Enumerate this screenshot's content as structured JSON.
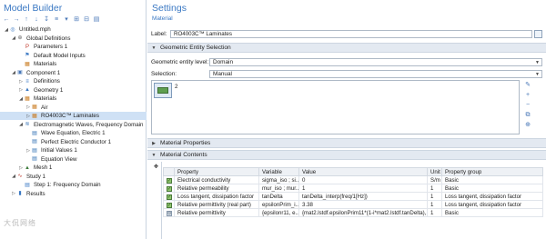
{
  "model_builder": {
    "title": "Model Builder",
    "toolbar": [
      "←",
      "→",
      "↑",
      "↓",
      "↧",
      "≡",
      "▾",
      "⊞",
      "⊟",
      "▤"
    ],
    "tree": [
      {
        "label": "Untitled.mph",
        "icon": "◎",
        "color": "#3a78c3",
        "twisty": "◢",
        "selected": false
      },
      {
        "label": "Global Definitions",
        "icon": "⊕",
        "color": "#6b6b6b",
        "twisty": "◢",
        "selected": false
      },
      {
        "label": "Parameters 1",
        "icon": "P",
        "color": "#c0392b",
        "twisty": "",
        "selected": false
      },
      {
        "label": "Default Model Inputs",
        "icon": "⚑",
        "color": "#3a78c3",
        "twisty": "",
        "selected": false
      },
      {
        "label": "Materials",
        "icon": "▦",
        "color": "#c97a1e",
        "twisty": "",
        "selected": false
      },
      {
        "label": "Component 1",
        "icon": "▣",
        "color": "#4a78b8",
        "twisty": "◢",
        "selected": false
      },
      {
        "label": "Definitions",
        "icon": "≡",
        "color": "#3a78c3",
        "twisty": "▷",
        "selected": false
      },
      {
        "label": "Geometry 1",
        "icon": "▲",
        "color": "#3a78c3",
        "twisty": "▷",
        "selected": false
      },
      {
        "label": "Materials",
        "icon": "▦",
        "color": "#c97a1e",
        "twisty": "◢",
        "selected": false
      },
      {
        "label": "Air",
        "icon": "▦",
        "color": "#c97a1e",
        "twisty": "▷",
        "selected": false
      },
      {
        "label": "RO4003C™ Laminates",
        "icon": "▦",
        "color": "#c97a1e",
        "twisty": "▷",
        "selected": true
      },
      {
        "label": "Electromagnetic Waves, Frequency Domain",
        "icon": "≋",
        "color": "#2f6fb3",
        "twisty": "◢",
        "selected": false
      },
      {
        "label": "Wave Equation, Electric 1",
        "icon": "▤",
        "color": "#2f6fb3",
        "twisty": "",
        "selected": false
      },
      {
        "label": "Perfect Electric Conductor 1",
        "icon": "▤",
        "color": "#2f6fb3",
        "twisty": "",
        "selected": false
      },
      {
        "label": "Initial Values 1",
        "icon": "▤",
        "color": "#2f6fb3",
        "twisty": "▷",
        "selected": false
      },
      {
        "label": "Equation View",
        "icon": "▤",
        "color": "#2f6fb3",
        "twisty": "",
        "selected": false
      },
      {
        "label": "Mesh 1",
        "icon": "▲",
        "color": "#3d7b3b",
        "twisty": "▷",
        "selected": false
      },
      {
        "label": "Study 1",
        "icon": "∿",
        "color": "#c0392b",
        "twisty": "◢",
        "selected": false
      },
      {
        "label": "Step 1: Frequency Domain",
        "icon": "▤",
        "color": "#3a78c3",
        "twisty": "",
        "selected": false
      },
      {
        "label": "Results",
        "icon": "▮",
        "color": "#3a78c3",
        "twisty": "▷",
        "selected": false
      }
    ]
  },
  "settings": {
    "title": "Settings",
    "subtitle": "Material",
    "label_caption": "Label:",
    "label_value": "RO4003C™ Laminates",
    "geo_section": "Geometric Entity Selection",
    "geo_level_caption": "Geometric entity level:",
    "geo_level_value": "Domain",
    "selection_caption": "Selection:",
    "selection_value": "Manual",
    "selection_list": "2",
    "side_tools": [
      "✎",
      "+",
      "−",
      "⧉",
      "⊕"
    ],
    "material_properties": "Material Properties",
    "material_contents": "Material Contents",
    "table": {
      "headers": [
        "",
        "Property",
        "Variable",
        "Value",
        "Unit",
        "Property group"
      ],
      "rows": [
        {
          "check": "✓",
          "property": "Electrical conductivity",
          "variable": "sigma_iso ; si...",
          "value": "0",
          "unit": "S/m",
          "group": "Basic"
        },
        {
          "check": "✓",
          "property": "Relative permeability",
          "variable": "mur_iso ; mur...",
          "value": "1",
          "unit": "1",
          "group": "Basic"
        },
        {
          "check": "✓",
          "property": "Loss tangent, dissipation factor",
          "variable": "tanDelta",
          "value": "tanDelta_interp(freq/1[Hz])",
          "unit": "1",
          "group": "Loss tangent, dissipation factor"
        },
        {
          "check": "✓",
          "property": "Relative permittivity (real part)",
          "variable": "epsilonPrim_i...",
          "value": "3.38",
          "unit": "1",
          "group": "Loss tangent, dissipation factor"
        },
        {
          "check": "⊙",
          "property": "Relative permittivity",
          "variable": "{epsilonr11, e...",
          "value": "{mat2.lstdf.epsilonPrim11*(1-i*mat2.lstdf.tanDelta),...",
          "unit": "1",
          "group": "Basic"
        }
      ]
    }
  },
  "watermark": "大侃网络"
}
